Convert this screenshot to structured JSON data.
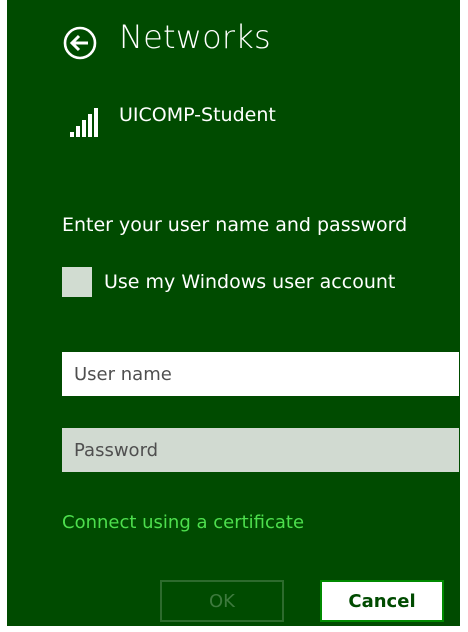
{
  "header": {
    "back_icon": "back-arrow-circle-icon",
    "title": "Networks"
  },
  "network": {
    "signal_icon": "wifi-signal-bars-icon",
    "name": "UICOMP-Student"
  },
  "form": {
    "prompt": "Enter your user name and password",
    "use_windows_account_label": "Use my Windows user account",
    "use_windows_account_checked": false,
    "username_placeholder": "User name",
    "username_value": "",
    "password_placeholder": "Password",
    "password_value": "",
    "certificate_link": "Connect using a certificate"
  },
  "buttons": {
    "ok_label": "OK",
    "ok_enabled": false,
    "cancel_label": "Cancel"
  },
  "colors": {
    "background": "#004b00",
    "link": "#4ddf4d",
    "accent_border": "#008a00"
  }
}
